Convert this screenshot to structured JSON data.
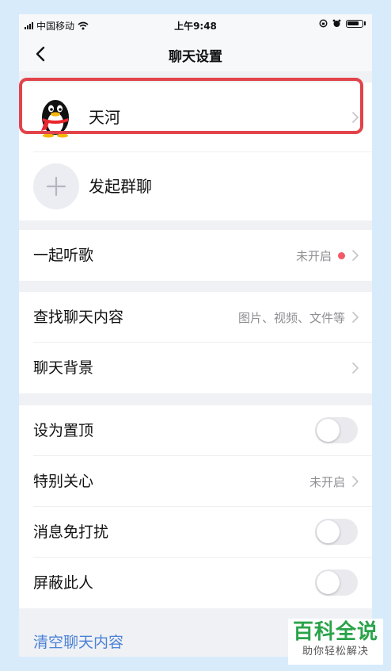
{
  "status_bar": {
    "carrier": "中国移动",
    "time": "上午9:48"
  },
  "nav": {
    "title": "聊天设置",
    "back_icon": "chevron-left-icon"
  },
  "contact": {
    "name": "天河",
    "avatar_icon": "qq-penguin-icon"
  },
  "group_chat": {
    "label": "发起群聊",
    "icon": "plus-icon"
  },
  "listen_together": {
    "label": "一起听歌",
    "status": "未开启"
  },
  "search_history": {
    "label": "查找聊天内容",
    "hint": "图片、视频、文件等"
  },
  "chat_background": {
    "label": "聊天背景"
  },
  "pin_top": {
    "label": "设为置顶",
    "enabled": false
  },
  "special_care": {
    "label": "特别关心",
    "status": "未开启"
  },
  "do_not_disturb": {
    "label": "消息免打扰",
    "enabled": false
  },
  "block_user": {
    "label": "屏蔽此人",
    "enabled": false
  },
  "clear_history": {
    "label": "清空聊天内容"
  },
  "watermark": {
    "title": "百科全说",
    "subtitle": "助你轻松解决"
  },
  "colors": {
    "page_bg": "#d8ebfb",
    "highlight": "#e2434a",
    "link": "#4b82d6",
    "dot": "#f05b66",
    "watermark_green": "#2aa34a"
  }
}
